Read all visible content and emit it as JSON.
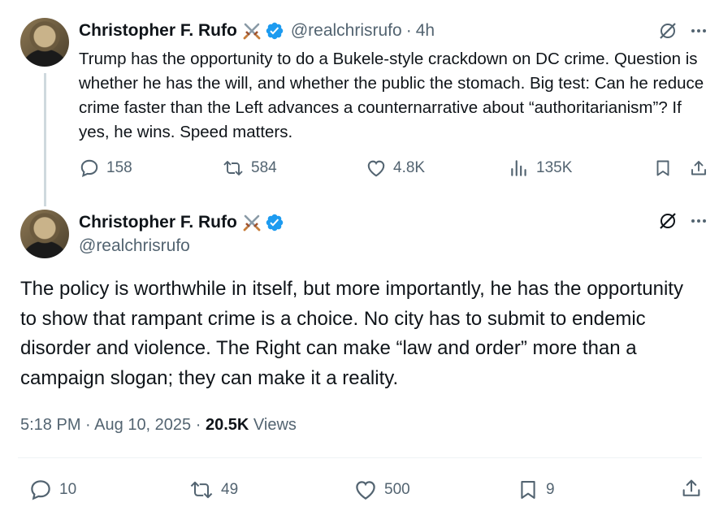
{
  "tweet1": {
    "author_name": "Christopher F. Rufo",
    "handle": "@realchrisrufo",
    "separator": "·",
    "time": "4h",
    "text": "Trump has the opportunity to do a Bukele-style crackdown on DC crime. Question is whether he has the will, and whether the public the stomach. Big test: Can he reduce crime faster than the Left advances a counternarrative about “authoritarianism”? If yes, he wins. Speed matters.",
    "replies": "158",
    "reposts": "584",
    "likes": "4.8K",
    "views": "135K"
  },
  "tweet2": {
    "author_name": "Christopher F. Rufo",
    "handle": "@realchrisrufo",
    "text": "The policy is worthwhile in itself, but more importantly, he has the opportunity to show that rampant crime is a choice. No city has to submit to endemic disorder and violence. The Right can make “law and order” more than a campaign slogan; they can make it a reality.",
    "time": "5:18 PM",
    "date": "Aug 10, 2025",
    "dot": "·",
    "views_count": "20.5K",
    "views_label": "Views",
    "replies": "10",
    "reposts": "49",
    "likes": "500",
    "bookmarks": "9"
  },
  "icons": {
    "verified_color": "#1d9bf0",
    "muted_color": "#536471",
    "names": [
      "swords-emoji-icon",
      "verified-badge-icon",
      "grok-icon",
      "more-icon",
      "reply-icon",
      "repost-icon",
      "like-icon",
      "views-icon",
      "bookmark-icon",
      "share-icon"
    ]
  }
}
